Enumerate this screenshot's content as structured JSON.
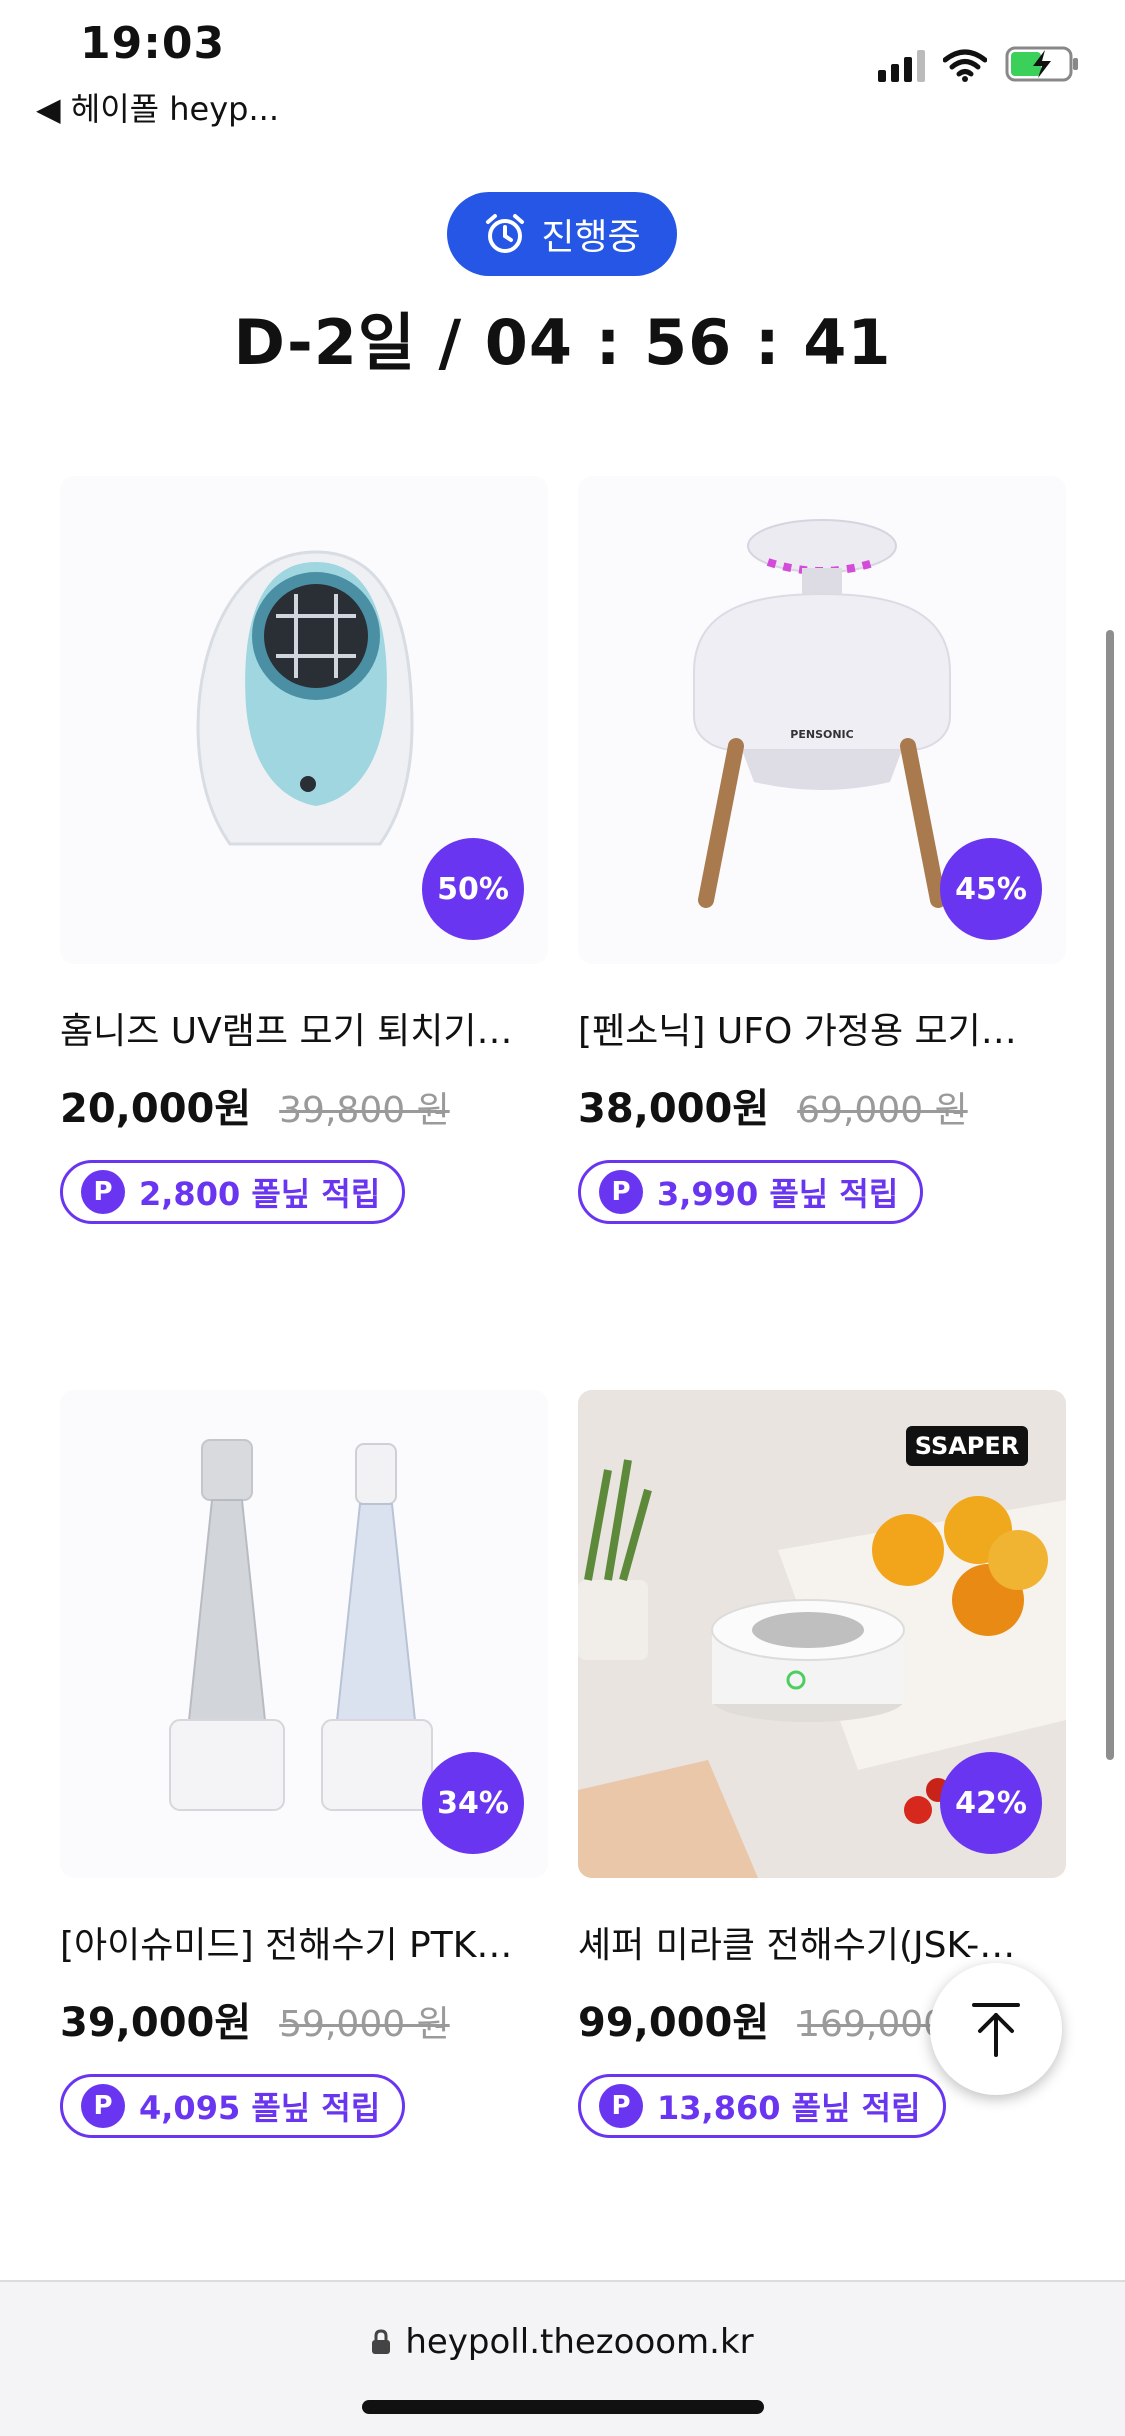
{
  "status_bar": {
    "time": "19:03",
    "back_label": "◀ 헤이폴 heyp..."
  },
  "deal": {
    "status_label": "진행중",
    "countdown": "D-2일 / 04 : 56 : 41"
  },
  "products": [
    {
      "title": "홈니즈 UV램프 모기 퇴치기…",
      "price": "20,000원",
      "original_price": "39,800 원",
      "discount": "50%",
      "points": "2,800 폴닢 적립"
    },
    {
      "title": "[펜소닉] UFO 가정용 모기…",
      "price": "38,000원",
      "original_price": "69,000 원",
      "discount": "45%",
      "points": "3,990 폴닢 적립"
    },
    {
      "title": "[아이슈미드] 전해수기 PTK…",
      "price": "39,000원",
      "original_price": "59,000 원",
      "discount": "34%",
      "points": "4,095 폴닢 적립"
    },
    {
      "title": "셰퍼 미라클 전해수기(JSK-…",
      "price": "99,000원",
      "original_price": "169,000",
      "discount": "42%",
      "points": "13,860 폴닢 적립"
    }
  ],
  "points_icon_letter": "P",
  "product_images": [
    "uv-lamp-mosquito-killer",
    "ufo-mosquito-trap",
    "electrolyzed-water-bottles",
    "ssaper-water-device"
  ],
  "product_brand_marks": [
    "PENSONIC",
    "SSAPER"
  ],
  "browser": {
    "url": "heypoll.thezooom.kr"
  },
  "colors": {
    "accent_blue": "#2656e6",
    "accent_purple": "#6a35f0"
  }
}
